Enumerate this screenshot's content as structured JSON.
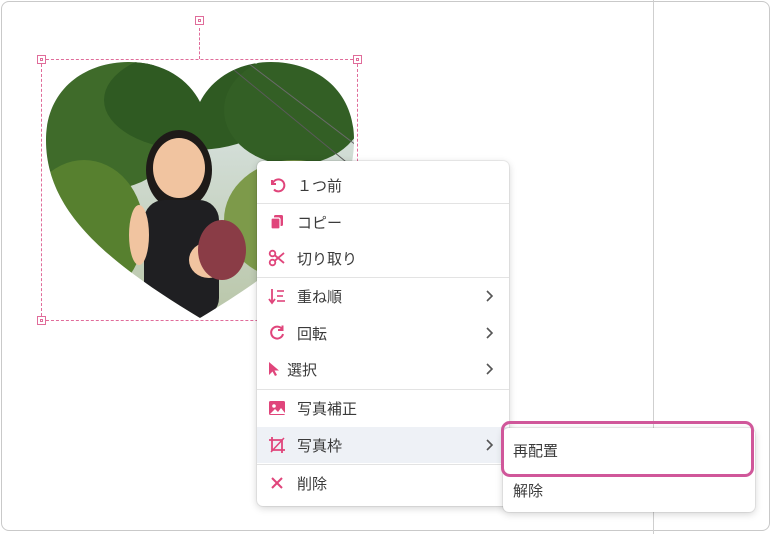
{
  "colors": {
    "accent_pink": "#d0579a",
    "icon_pink": "#e0457b",
    "selection_pink": "#e06c9a"
  },
  "photo": {
    "shape": "heart"
  },
  "context_menu": {
    "items": [
      {
        "label": "１つ前",
        "icon": "undo-icon",
        "submenu": false
      },
      {
        "label": "コピー",
        "icon": "copy-icon",
        "submenu": false
      },
      {
        "label": "切り取り",
        "icon": "scissors-icon",
        "submenu": false
      },
      {
        "label": "重ね順",
        "icon": "layer-order-icon",
        "submenu": true
      },
      {
        "label": "回転",
        "icon": "rotate-icon",
        "submenu": true
      },
      {
        "label": "選択",
        "icon": "cursor-icon",
        "submenu": true
      },
      {
        "label": "写真補正",
        "icon": "photo-adjust-icon",
        "submenu": false
      },
      {
        "label": "写真枠",
        "icon": "crop-frame-icon",
        "submenu": true,
        "active": true
      },
      {
        "label": "削除",
        "icon": "delete-icon",
        "submenu": false
      }
    ]
  },
  "submenu": {
    "items": [
      {
        "label": "再配置",
        "highlighted": true
      },
      {
        "label": "解除"
      }
    ]
  }
}
